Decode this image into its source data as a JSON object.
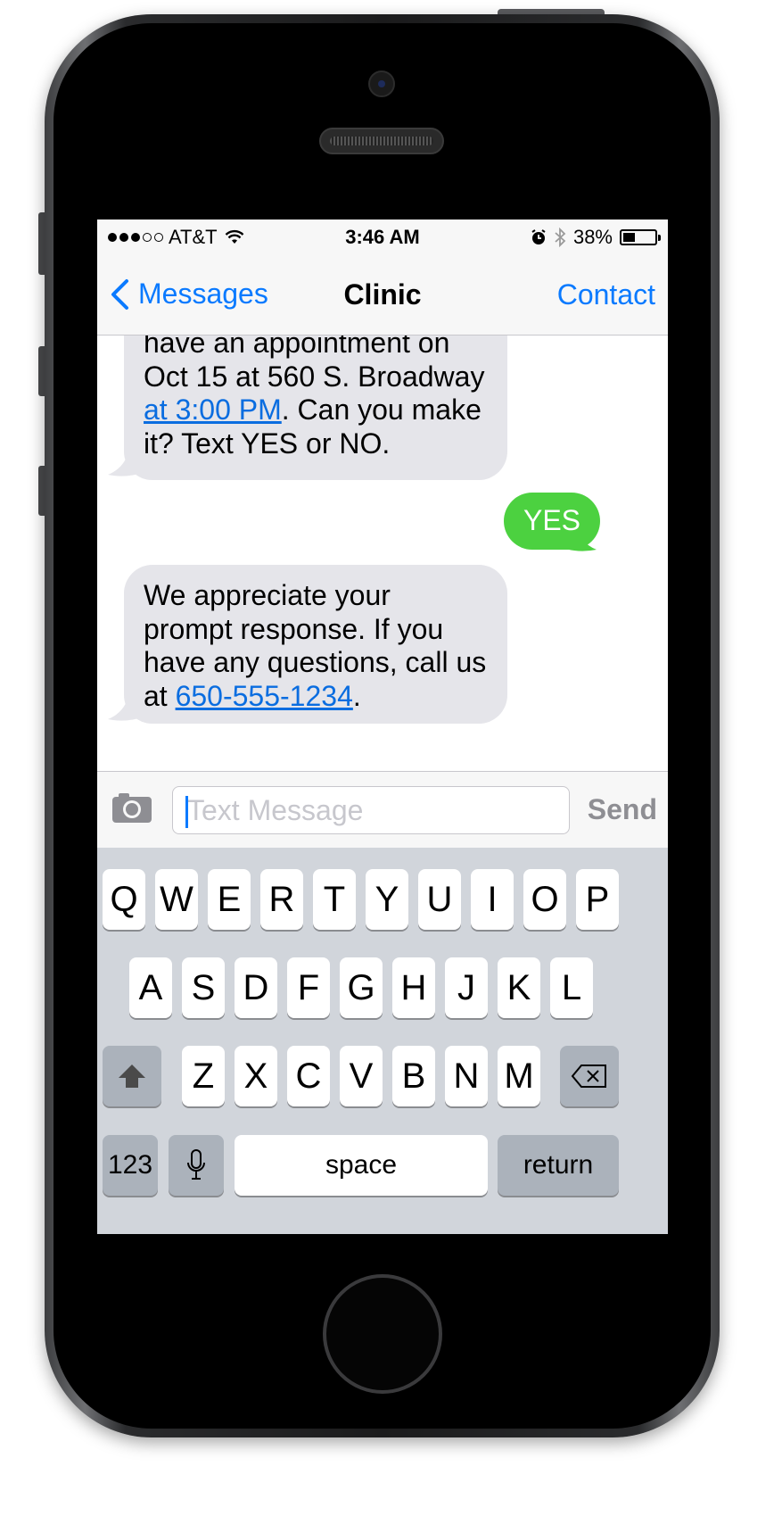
{
  "status_bar": {
    "carrier": "AT&T",
    "time": "3:46 AM",
    "battery_percent_label": "38%",
    "battery_level": 0.38,
    "signal_bars_filled": 3,
    "signal_bars_total": 5,
    "icons": [
      "wifi-icon",
      "alarm-icon",
      "bluetooth-icon",
      "battery-icon"
    ]
  },
  "nav": {
    "back_label": "Messages",
    "title": "Clinic",
    "contact_label": "Contact"
  },
  "messages": {
    "m1": {
      "direction": "incoming",
      "line1": "have an appointment on",
      "line2": "Oct 15 at 560 S. Broadway",
      "link": "at 3:00 PM",
      "after_link": ". Can you make",
      "line4": "it? Text YES or NO."
    },
    "m2": {
      "direction": "outgoing",
      "text": "YES"
    },
    "m3": {
      "direction": "incoming",
      "line1": "We appreciate your",
      "line2": "prompt response. If you",
      "line3": "have any questions, call us",
      "prefix": "at ",
      "link": "650-555-1234",
      "suffix": "."
    }
  },
  "composer": {
    "placeholder": "Text Message",
    "send_label": "Send"
  },
  "keyboard": {
    "row1": [
      "Q",
      "W",
      "E",
      "R",
      "T",
      "Y",
      "U",
      "I",
      "O",
      "P"
    ],
    "row2": [
      "A",
      "S",
      "D",
      "F",
      "G",
      "H",
      "J",
      "K",
      "L"
    ],
    "row3": [
      "Z",
      "X",
      "C",
      "V",
      "B",
      "N",
      "M"
    ],
    "numbers_label": "123",
    "space_label": "space",
    "return_label": "return"
  },
  "colors": {
    "accent": "#0a7aff",
    "outgoing_bubble": "#4cd140",
    "incoming_bubble": "#e5e5ea"
  }
}
